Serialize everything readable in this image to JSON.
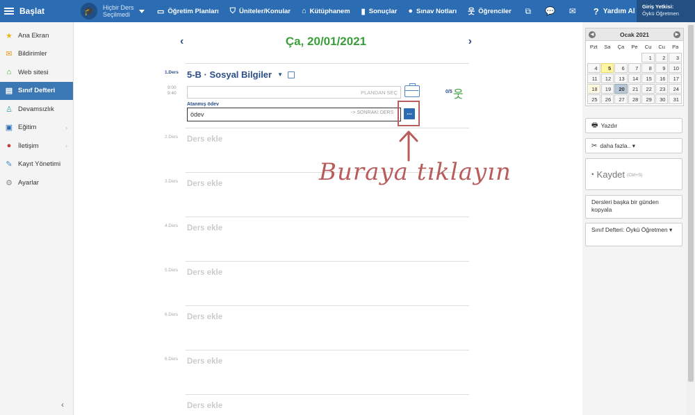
{
  "topbar": {
    "start_label": "Başlat",
    "course_selector": "Hiçbir Ders Seçilmedi",
    "nav": [
      {
        "icon": "calendar-icon",
        "label": "Öğretim Planları"
      },
      {
        "icon": "shield-icon",
        "label": "Üniteler/Konular"
      },
      {
        "icon": "library-icon",
        "label": "Kütüphanem"
      },
      {
        "icon": "bar-chart-icon",
        "label": "Sonuçlar"
      },
      {
        "icon": "exam-icon",
        "label": "Sınav Notları"
      },
      {
        "icon": "students-icon",
        "label": "Öğrenciler"
      }
    ],
    "help_label": "Yardım Al",
    "login_label": "Giriş Yetkisi:",
    "login_user": "Öykü Öğretmen"
  },
  "sidebar": {
    "items": [
      {
        "label": "Ana Ekran",
        "icon": "star-icon"
      },
      {
        "label": "Bildirimler",
        "icon": "envelope-icon"
      },
      {
        "label": "Web sitesi",
        "icon": "home-icon"
      },
      {
        "label": "Sınıf Defteri",
        "icon": "notebook-icon",
        "active": true
      },
      {
        "label": "Devamsızlık",
        "icon": "person-icon"
      },
      {
        "label": "Eğitim",
        "icon": "briefcase-icon",
        "has_sub": true
      },
      {
        "label": "İletişim",
        "icon": "chat-icon",
        "has_sub": true
      },
      {
        "label": "Kayıt Yönetimi",
        "icon": "pencil-icon"
      },
      {
        "label": "Ayarlar",
        "icon": "gear-icon"
      }
    ]
  },
  "main": {
    "date": "Ça, 20/01/2021",
    "lesson1": {
      "number": "1.Ders",
      "time_start": "9:00",
      "time_end": "9:40",
      "class_name": "5-B · Sosyal Bilgiler",
      "plan_placeholder": "PLANDAN SEÇ",
      "attendance_count": "0/5",
      "homework_label": "Atanmış ödev",
      "homework_value": "ödev",
      "next_lesson_label": "-> SONRAKİ DERS",
      "more_button": "..."
    },
    "lessons": [
      {
        "number": "2.Ders",
        "add": "Ders ekle"
      },
      {
        "number": "3.Ders",
        "add": "Ders ekle"
      },
      {
        "number": "4.Ders",
        "add": "Ders ekle"
      },
      {
        "number": "5.Ders",
        "add": "Ders ekle"
      },
      {
        "number": "6.Ders",
        "add": "Ders ekle"
      },
      {
        "number": "6.Ders",
        "add": "Ders ekle"
      },
      {
        "number": "",
        "add": "Ders ekle"
      }
    ],
    "annotation": "Buraya tıklayın"
  },
  "calendar": {
    "month": "Ocak 2021",
    "dow": [
      "Pzt",
      "Sa",
      "Ça",
      "Pe",
      "Cu",
      "Cu",
      "Pa"
    ],
    "weeks": [
      [
        "",
        "",
        "",
        "",
        "1",
        "2",
        "3"
      ],
      [
        "4",
        "5",
        "6",
        "7",
        "8",
        "9",
        "10"
      ],
      [
        "11",
        "12",
        "13",
        "14",
        "15",
        "16",
        "17"
      ],
      [
        "18",
        "19",
        "20",
        "21",
        "22",
        "23",
        "24"
      ],
      [
        "25",
        "26",
        "27",
        "28",
        "29",
        "30",
        "31"
      ]
    ],
    "today": "5",
    "selected": "20",
    "marked": "18"
  },
  "actions": {
    "print": "Yazdır",
    "more": "daha fazla.. ▾",
    "save": "Kaydet",
    "save_shortcut": "(Ctrl+S)",
    "copy": "Dersleri başka bir günden kopyala",
    "notebook": "Sınıf Defteri: Öykü Öğretmen ▾"
  },
  "colors": {
    "primary": "#2b6cb3",
    "date_green": "#3a9e3a",
    "annotation": "#b85c5c"
  }
}
